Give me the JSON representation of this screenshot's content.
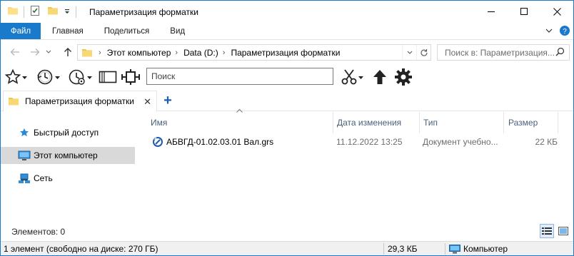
{
  "window": {
    "title": "Параметризация форматки",
    "minimize_glyph": "—",
    "maximize_glyph": "☐",
    "close_glyph": "✕"
  },
  "ribbon": {
    "tabs": [
      "Файл",
      "Главная",
      "Поделиться",
      "Вид"
    ]
  },
  "address": {
    "crumbs": [
      "Этот компьютер",
      "Data (D:)",
      "Параметризация форматки"
    ],
    "search_placeholder": "Поиск в: Параметризация..."
  },
  "toolbar": {
    "search_label": "Поиск"
  },
  "tabs": {
    "active_label": "Параметризация форматки",
    "close_glyph": "✕",
    "new_tab_glyph": "+"
  },
  "nav": {
    "items": [
      {
        "label": "Быстрый доступ",
        "icon": "star-icon",
        "selected": false
      },
      {
        "label": "Этот компьютер",
        "icon": "computer-icon",
        "selected": true
      },
      {
        "label": "Сеть",
        "icon": "network-icon",
        "selected": false
      }
    ]
  },
  "columns": [
    "Имя",
    "Дата изменения",
    "Тип",
    "Размер"
  ],
  "files": [
    {
      "name": "АБВГД-01.02.03.01 Вал.grs",
      "modified": "11.12.2022 13:25",
      "type": "Документ учебно...",
      "size": "22 КБ",
      "icon": "grs-file-icon"
    }
  ],
  "footer": {
    "items_count": "Элементов: 0"
  },
  "statusbar": {
    "selection": "1 элемент (свободно на диске: 270 ГБ)",
    "size": "29,3 КБ",
    "location": "Компьютер"
  },
  "colors": {
    "accent": "#1979ca",
    "selection": "#d9d9d9",
    "column_header_text": "#4c607a"
  }
}
